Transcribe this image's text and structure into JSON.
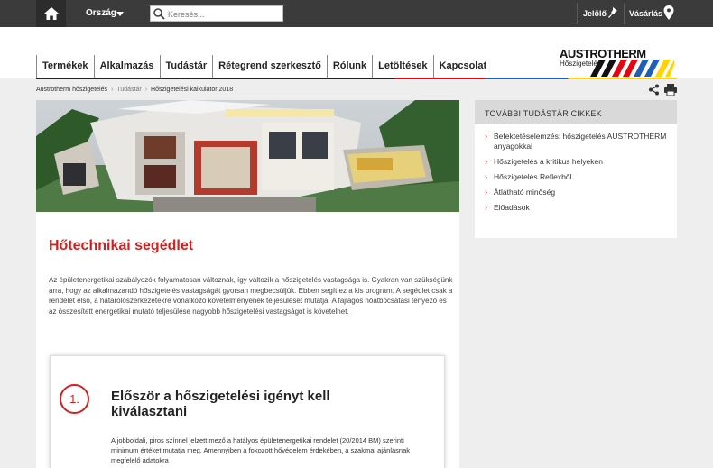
{
  "topbar": {
    "country_label": "Ország",
    "search_placeholder": "Keresés...",
    "marker_label": "Jelölő",
    "buy_label": "Vásárlás"
  },
  "nav": [
    "Termékek",
    "Alkalmazás",
    "Tudástár",
    "Rétegrend szerkesztő",
    "Rólunk",
    "Letöltések",
    "Kapcsolat"
  ],
  "logo": {
    "name": "AUSTROTHERM",
    "sub": "Hőszigetelés"
  },
  "breadcrumb": {
    "items": [
      "Austrotherm hőszigetelés",
      "Tudástár",
      "Hőszigetelési kalkulátor 2018"
    ]
  },
  "main": {
    "title": "Hőtechnikai segédlet",
    "intro": "Az épületenergetikai szabályozók folyamatosan változnak, így változik a hőszigetelés vastagsága is. Gyakran van szükségünk arra, hogy az alkalmazandó hőszigetelés vastagságát gyorsan megbecsüljük. Ebben segít ez a kis program. A segédlet csak a rendelet első, a határolószerkezetekre vonatkozó követelményének teljesülését mutatja. A fajlagos hőátbocsátási tényező és az összesített energetikai mutató teljesülése nagyobb hőszigetelési vastagságot is követelhet.",
    "step": {
      "number": "1.",
      "title": "Először a hőszigetelési igényt kell kiválasztani",
      "text": "A jobboldali, piros színnel jelzett mező a hatályos épületenergetikai rendelet (20/2014 BM) szerinti minimum értéket mutatja meg. Amennyiben a fokozott hővédelem érdekében, a szakmai ajánlásnak megfelelő adatokra"
    }
  },
  "sidebar": {
    "title": "TOVÁBBI TUDÁSTÁR CIKKEK",
    "items": [
      "Befektetéselemzés: hőszigetelés AUSTROTHERM anyagokkal",
      "Hőszigetelés a kritikus helyeken",
      "Hőszigetelés Reflexből",
      "Átlátható minőség",
      "Előadások"
    ]
  },
  "colors": {
    "accent_red": "#d21f1f",
    "topbar": "#3b3b3b",
    "brand_blue": "#1f5fb6",
    "brand_yellow": "#ffd400"
  },
  "icons": [
    "home-icon",
    "search-icon",
    "pin-icon",
    "location-icon",
    "share-icon",
    "print-icon"
  ]
}
